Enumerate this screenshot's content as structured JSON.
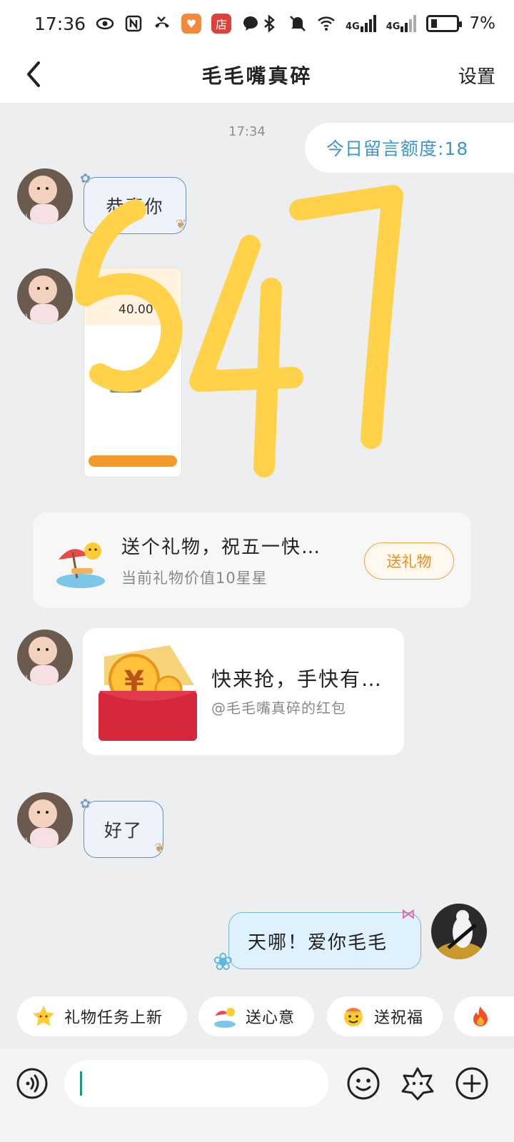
{
  "status_bar": {
    "time": "17:36",
    "app_badge_1": "店",
    "net_label_1": "4G",
    "net_label_2": "4G",
    "battery": "7%"
  },
  "nav": {
    "title": "毛毛嘴真碎",
    "settings_label": "设置"
  },
  "chat": {
    "timestamp": "17:34",
    "quota_text": "今日留言额度:18",
    "messages": [
      {
        "text": "恭喜你"
      },
      {
        "text": "好了"
      },
      {
        "text": "天哪！爱你毛毛"
      }
    ],
    "shared_image": {
      "amount": "40.00"
    },
    "overlay_scrawl": "547",
    "gift_card": {
      "title": "送个礼物，祝五一快…",
      "subtitle": "当前礼物价值10星星",
      "button_label": "送礼物"
    },
    "red_packet": {
      "title": "快来抢，手快有…",
      "subtitle": "@毛毛嘴真碎的红包"
    }
  },
  "quick_chips": [
    {
      "label": "礼物任务上新",
      "icon": "star-icon"
    },
    {
      "label": "送心意",
      "icon": "beach-icon"
    },
    {
      "label": "送祝福",
      "icon": "emoji-icon"
    },
    {
      "label": "",
      "icon": "fire-icon"
    }
  ],
  "input_bar": {
    "placeholder": ""
  },
  "colors": {
    "quota_text": "#3c95d3",
    "gift_button": "#f08b1e",
    "scrawl": "#ffd24a",
    "red_packet": "#d5283a"
  }
}
